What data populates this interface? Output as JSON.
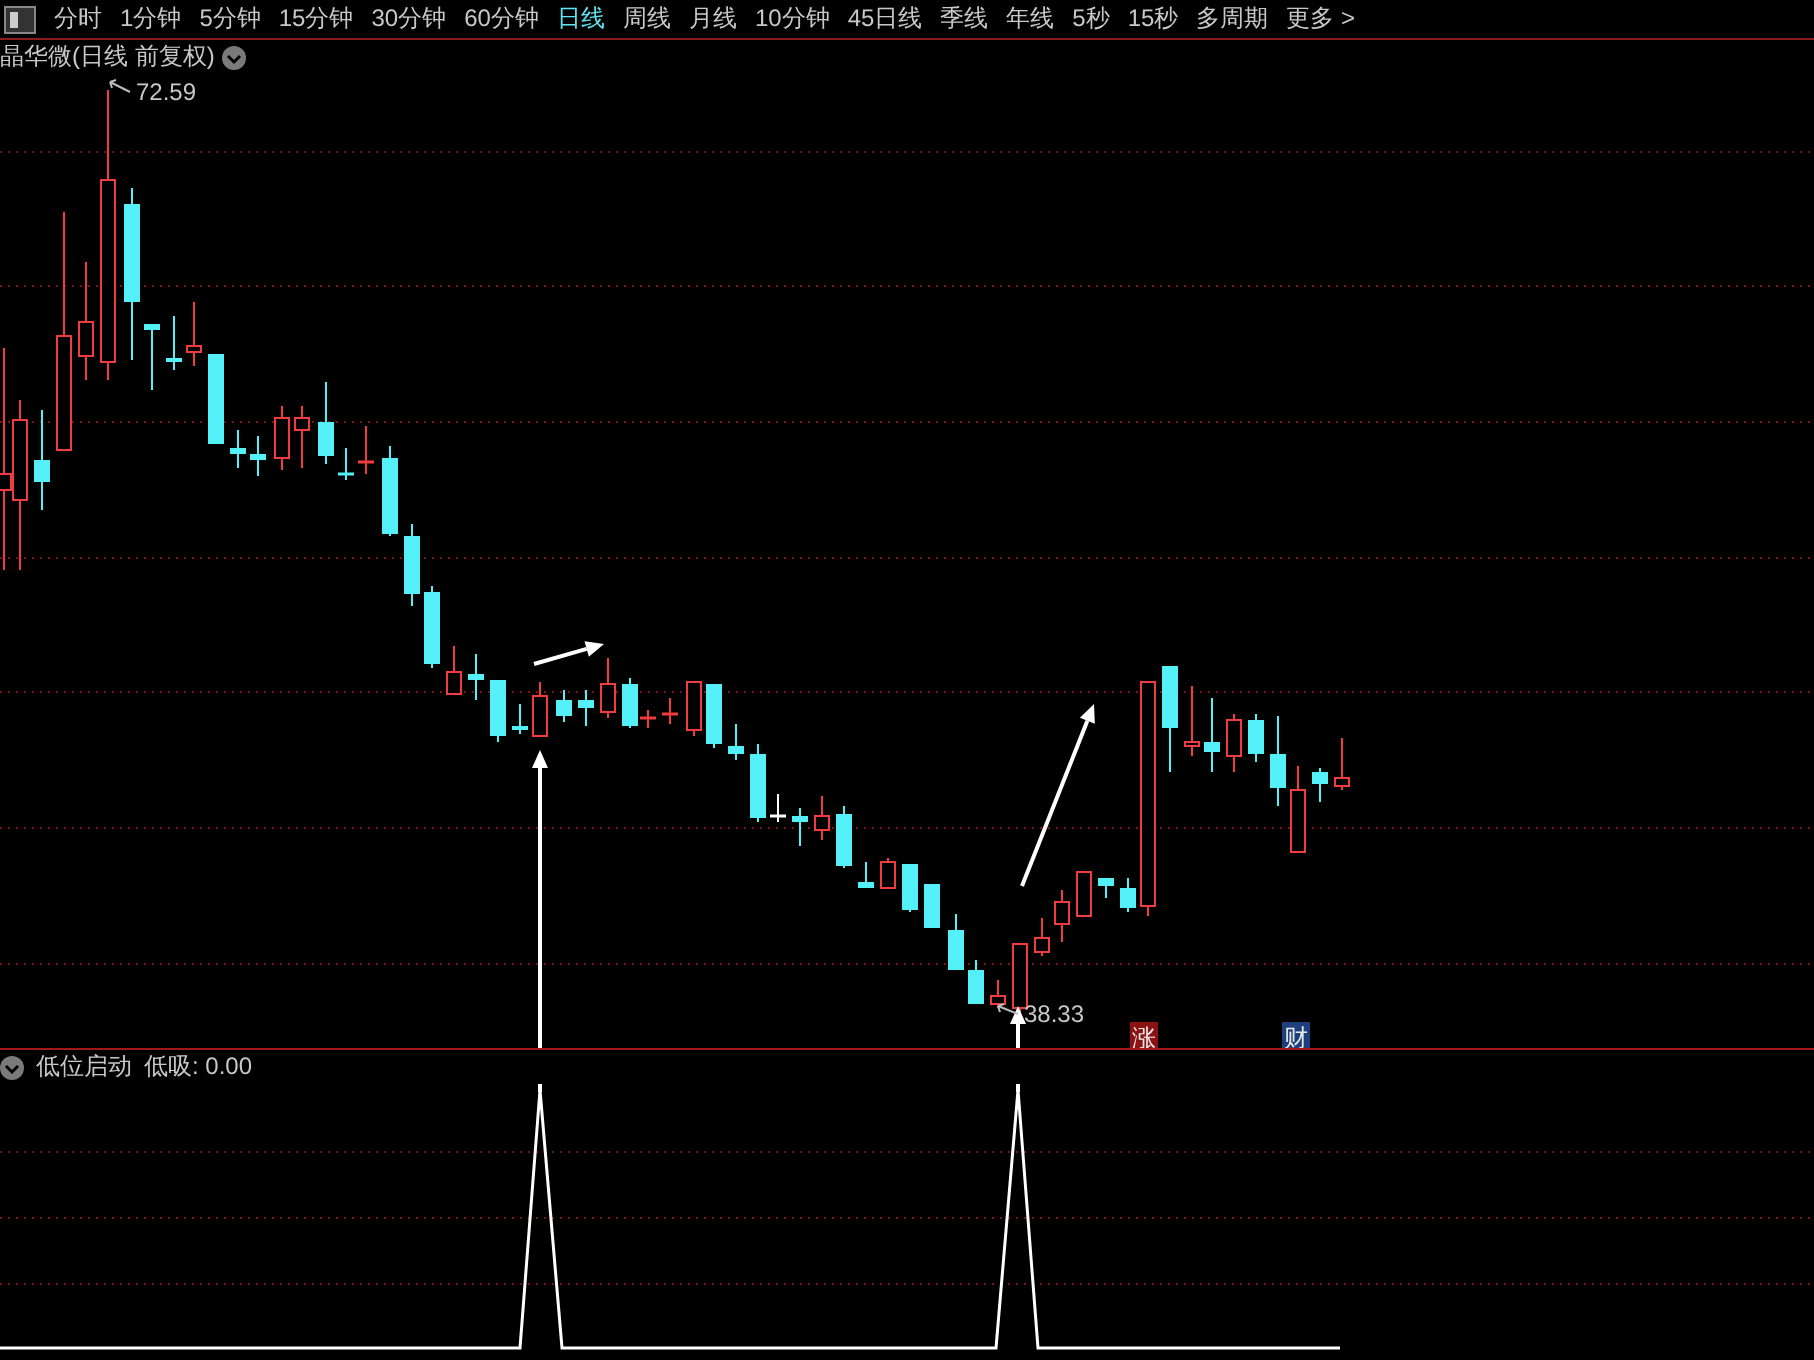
{
  "toolbar": {
    "tabs": [
      {
        "label": "分时",
        "selected": false
      },
      {
        "label": "1分钟",
        "selected": false
      },
      {
        "label": "5分钟",
        "selected": false
      },
      {
        "label": "15分钟",
        "selected": false
      },
      {
        "label": "30分钟",
        "selected": false
      },
      {
        "label": "60分钟",
        "selected": false
      },
      {
        "label": "日线",
        "selected": true
      },
      {
        "label": "周线",
        "selected": false
      },
      {
        "label": "月线",
        "selected": false
      },
      {
        "label": "10分钟",
        "selected": false
      },
      {
        "label": "45日线",
        "selected": false
      },
      {
        "label": "季线",
        "selected": false
      },
      {
        "label": "年线",
        "selected": false
      },
      {
        "label": "5秒",
        "selected": false
      },
      {
        "label": "15秒",
        "selected": false
      },
      {
        "label": "多周期",
        "selected": false
      },
      {
        "label": "更多 >",
        "selected": false
      }
    ]
  },
  "main_chart": {
    "title": "晶华微(日线 前复权)",
    "high_label": "72.59",
    "low_label": "38.33",
    "badges": [
      {
        "label": "涨",
        "color": "#8a1212"
      },
      {
        "label": "财",
        "color": "#1d3f7c"
      }
    ]
  },
  "indicator": {
    "name": "低位启动",
    "reading": "低吸: 0.00"
  }
}
